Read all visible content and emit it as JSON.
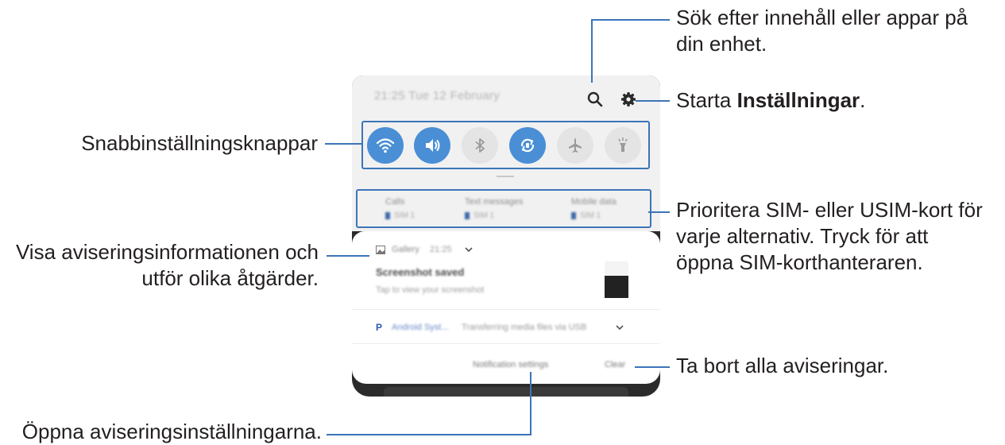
{
  "phone": {
    "status_time": "21:25  Tue 12 February",
    "quick_settings": [
      {
        "name": "wifi",
        "state": "on"
      },
      {
        "name": "sound",
        "state": "on"
      },
      {
        "name": "bluetooth",
        "state": "off"
      },
      {
        "name": "auto-rotate",
        "state": "on"
      },
      {
        "name": "airplane-mode",
        "state": "off"
      },
      {
        "name": "flashlight",
        "state": "off"
      }
    ],
    "sim_options": [
      {
        "label": "Calls",
        "sim": "SIM 1"
      },
      {
        "label": "Text messages",
        "sim": "SIM 1"
      },
      {
        "label": "Mobile data",
        "sim": "SIM 1"
      }
    ],
    "notification": {
      "app": "Gallery",
      "time": "21:25",
      "title": "Screenshot saved",
      "body": "Tap to view your screenshot"
    },
    "notification2": {
      "app": "Android Syst...",
      "text": "Transferring media files via USB"
    },
    "actions": {
      "notification_settings": "Notification settings",
      "clear": "Clear"
    }
  },
  "callouts": {
    "search_line1": "Sök efter innehåll eller appar på",
    "search_line2": "din enhet.",
    "settings_prefix": "Starta ",
    "settings_bold": "Inställningar",
    "settings_suffix": ".",
    "quick_settings": "Snabbinställningsknappar",
    "sim_line1": "Prioritera SIM- eller USIM-kort för",
    "sim_line2": "varje alternativ. Tryck för att",
    "sim_line3": "öppna SIM-korthanteraren.",
    "notif_line1": "Visa aviseringsinformationen och",
    "notif_line2": "utför olika åtgärder.",
    "clear": "Ta bort alla aviseringar.",
    "notif_settings": "Öppna aviseringsinställningarna."
  },
  "colors": {
    "accent": "#3c74b8",
    "toggle_on": "#4a8fd6",
    "toggle_off": "#e4e4e4",
    "text": "#231f20"
  }
}
